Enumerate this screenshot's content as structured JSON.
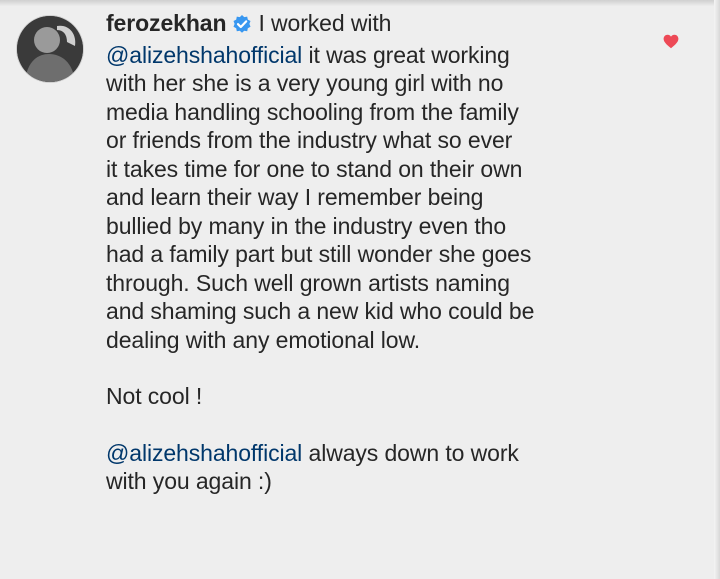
{
  "comment": {
    "username": "ferozekhan",
    "verified": true,
    "intro": "I worked with",
    "mention_1": "@alizehshahofficial",
    "lines": [
      "it was great working",
      "with her she is a very young girl with no",
      "media handling schooling from the family",
      "or friends from the industry  what so ever",
      "it takes time for one to stand on their own",
      "and learn their way I remember being",
      "bullied by many in the industry even tho",
      "had a family part but still wonder she goes",
      "through. Such well grown artists naming",
      "and shaming such a new kid who could be",
      "dealing with any emotional low."
    ],
    "closing": "Not cool !",
    "mention_2": "@alizehshahofficial",
    "final_line_1": "always down to work",
    "final_line_2": "with you again :)"
  },
  "icons": {
    "verified_badge": "verified-badge-icon",
    "like": "heart-icon",
    "like_color": "#ed4956",
    "verified_color": "#3897f0",
    "mention_color": "#00376b"
  }
}
